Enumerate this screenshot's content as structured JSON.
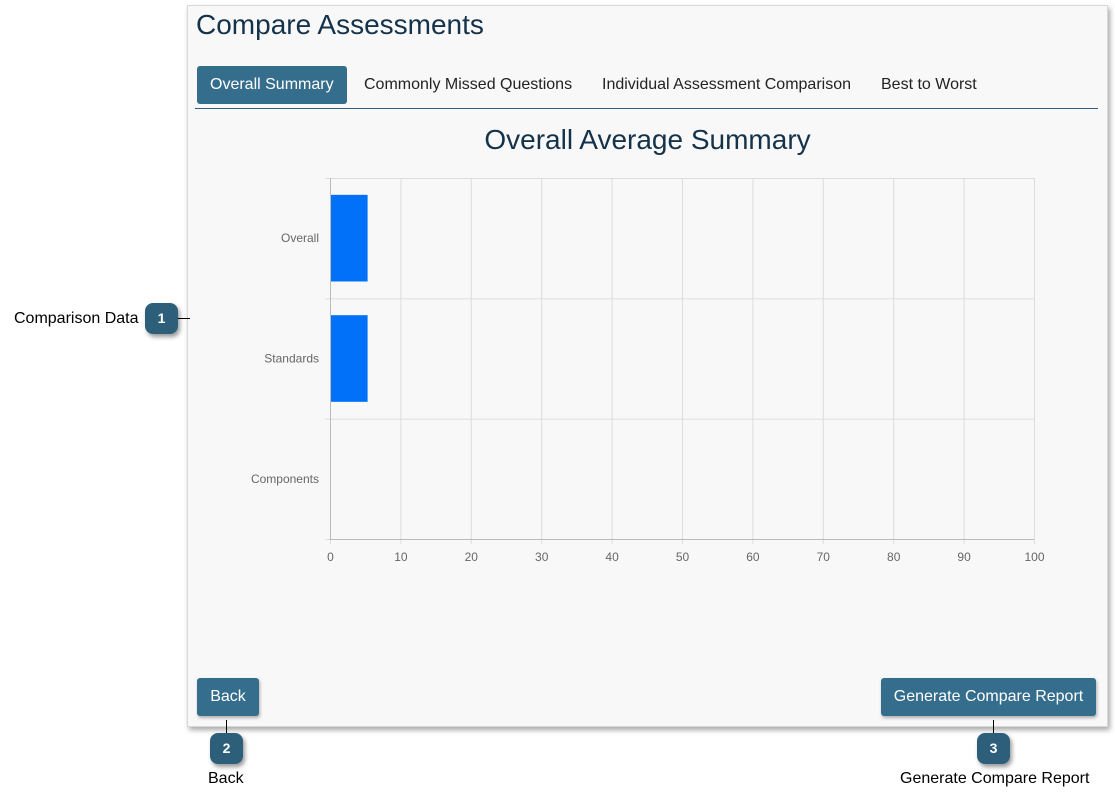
{
  "page": {
    "title": "Compare Assessments"
  },
  "tabs": [
    {
      "label": "Overall Summary",
      "active": true
    },
    {
      "label": "Commonly Missed Questions",
      "active": false
    },
    {
      "label": "Individual Assessment Comparison",
      "active": false
    },
    {
      "label": "Best to Worst",
      "active": false
    }
  ],
  "buttons": {
    "back": "Back",
    "generate": "Generate Compare Report"
  },
  "callouts": [
    {
      "number": "1",
      "label": "Comparison Data"
    },
    {
      "number": "2",
      "label": "Back"
    },
    {
      "number": "3",
      "label": "Generate Compare Report"
    }
  ],
  "chart_data": {
    "type": "bar",
    "orientation": "horizontal",
    "title": "Overall Average Summary",
    "categories": [
      "Overall",
      "Standards",
      "Components"
    ],
    "values": [
      5.2,
      5.2,
      0
    ],
    "xlim": [
      0,
      100
    ],
    "xticks": [
      0,
      10,
      20,
      30,
      40,
      50,
      60,
      70,
      80,
      90,
      100
    ],
    "grid": true,
    "legend": "none",
    "bar_color": "#0071f8"
  }
}
